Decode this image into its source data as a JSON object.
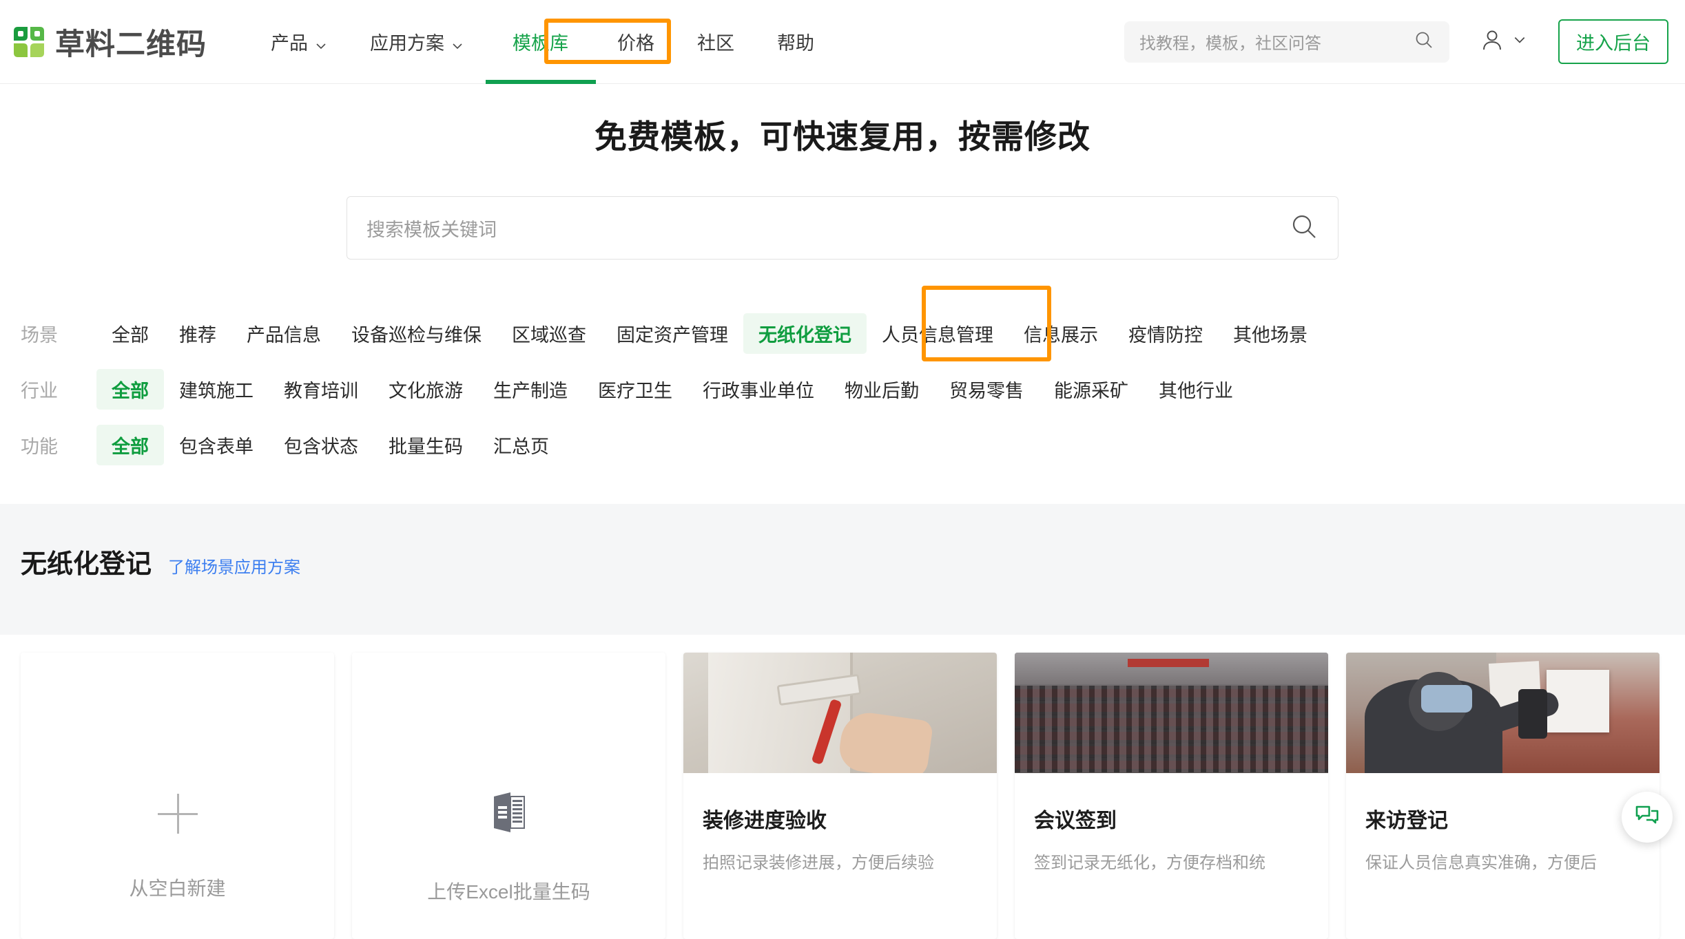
{
  "brand": {
    "name": "草料二维码",
    "logo_colors": [
      "#1a9c3e",
      "#56b847",
      "#8cc63f",
      "#a6d45a"
    ]
  },
  "header": {
    "nav": [
      {
        "label": "产品",
        "has_caret": true,
        "active": false
      },
      {
        "label": "应用方案",
        "has_caret": true,
        "active": false
      },
      {
        "label": "模板库",
        "has_caret": false,
        "active": true,
        "highlighted": true
      },
      {
        "label": "价格",
        "has_caret": false,
        "active": false
      },
      {
        "label": "社区",
        "has_caret": false,
        "active": false
      },
      {
        "label": "帮助",
        "has_caret": false,
        "active": false
      }
    ],
    "search_placeholder": "找教程，模板，社区问答",
    "search_value": "",
    "enter_console_label": "进入后台"
  },
  "hero": {
    "title": "免费模板，可快速复用，按需修改",
    "search_placeholder": "搜索模板关键词",
    "search_value": ""
  },
  "filters": [
    {
      "label": "场景",
      "items": [
        {
          "label": "全部",
          "selected": false
        },
        {
          "label": "推荐",
          "selected": false
        },
        {
          "label": "产品信息",
          "selected": false
        },
        {
          "label": "设备巡检与维保",
          "selected": false
        },
        {
          "label": "区域巡查",
          "selected": false
        },
        {
          "label": "固定资产管理",
          "selected": false
        },
        {
          "label": "无纸化登记",
          "selected": true,
          "highlighted": true
        },
        {
          "label": "人员信息管理",
          "selected": false
        },
        {
          "label": "信息展示",
          "selected": false
        },
        {
          "label": "疫情防控",
          "selected": false
        },
        {
          "label": "其他场景",
          "selected": false
        }
      ]
    },
    {
      "label": "行业",
      "items": [
        {
          "label": "全部",
          "selected": true
        },
        {
          "label": "建筑施工",
          "selected": false
        },
        {
          "label": "教育培训",
          "selected": false
        },
        {
          "label": "文化旅游",
          "selected": false
        },
        {
          "label": "生产制造",
          "selected": false
        },
        {
          "label": "医疗卫生",
          "selected": false
        },
        {
          "label": "行政事业单位",
          "selected": false
        },
        {
          "label": "物业后勤",
          "selected": false
        },
        {
          "label": "贸易零售",
          "selected": false
        },
        {
          "label": "能源采矿",
          "selected": false
        },
        {
          "label": "其他行业",
          "selected": false
        }
      ]
    },
    {
      "label": "功能",
      "items": [
        {
          "label": "全部",
          "selected": true
        },
        {
          "label": "包含表单",
          "selected": false
        },
        {
          "label": "包含状态",
          "selected": false
        },
        {
          "label": "批量生码",
          "selected": false
        },
        {
          "label": "汇总页",
          "selected": false
        }
      ]
    }
  ],
  "section": {
    "title": "无纸化登记",
    "link": "了解场景应用方案"
  },
  "cards": [
    {
      "kind": "blank",
      "icon": "plus-icon",
      "label": "从空白新建"
    },
    {
      "kind": "blank",
      "icon": "excel-icon",
      "label": "上传Excel批量生码"
    },
    {
      "kind": "template",
      "thumb": "t-paint",
      "title": "装修进度验收",
      "desc": "拍照记录装修进展，方便后续验"
    },
    {
      "kind": "template",
      "thumb": "t-hall",
      "title": "会议签到",
      "desc": "签到记录无纸化，方便存档和统"
    },
    {
      "kind": "template",
      "thumb": "t-qr",
      "title": "来访登记",
      "desc": "保证人员信息真实准确，方便后"
    }
  ],
  "fab": {
    "icon": "chat-bubble-icon",
    "color": "#10a050"
  },
  "colors": {
    "brand_green": "#16a34a",
    "annotation_orange": "#ff9500",
    "link_blue": "#3d7ff0",
    "selected_bg": "#eef8f0"
  }
}
